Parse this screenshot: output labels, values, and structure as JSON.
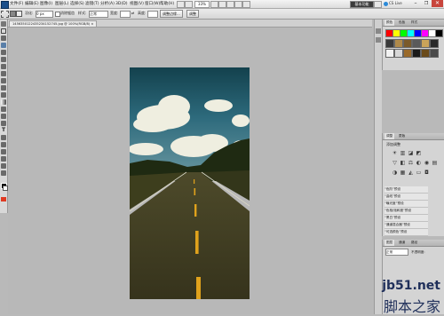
{
  "menubar": {
    "items": [
      "文件(F)",
      "编辑(E)",
      "图像(I)",
      "图层(L)",
      "选择(S)",
      "滤镜(T)",
      "分析(A)",
      "3D(D)",
      "视图(V)",
      "窗口(W)",
      "帮助(H)"
    ],
    "zoom": "33%",
    "workspace_button": "基本功能",
    "cloud_button": "CS Live"
  },
  "options": {
    "feather_label": "羽化:",
    "feather_value": "0 px",
    "antialias_label": "消除锯齿",
    "style_label": "样式:",
    "style_value": "正常",
    "width_label": "宽度:",
    "height_label": "高度:",
    "refine_edge_button": "调整边缘...",
    "unit_button": "调整"
  },
  "document": {
    "tab_title": "1456350122435234152745.jpg @ 100%(RGB/8)"
  },
  "panels": {
    "color_tabs": [
      "颜色",
      "色板",
      "样式"
    ],
    "adjustments_tabs": [
      "调整",
      "蒙版"
    ],
    "adjustments_title": "添加调整",
    "presets": [
      "“色阶”预设",
      "“曲线”预设",
      "“曝光度”预设",
      "“色相/饱和度”预设",
      "“黑白”预设",
      "“通道混合器”预设",
      "“可选颜色”预设"
    ],
    "layers_tabs": [
      "图层",
      "通道",
      "路径"
    ],
    "layer_blend": "正常",
    "layer_opacity": "不透明度:"
  },
  "colors": {
    "swatch_row1": [
      "#ff0000",
      "#ffff00",
      "#00ff00",
      "#00ffff",
      "#0000ff",
      "#ff00ff",
      "#ffffff",
      "#000000"
    ],
    "swatch_row2": [
      "#aa5500",
      "#ffaa00",
      "#55aa00",
      "#005555",
      "#552288",
      "#aa0055",
      "#888888",
      "#444444"
    ]
  },
  "watermark": {
    "site": "jb51.net",
    "name": "脚本之家"
  }
}
